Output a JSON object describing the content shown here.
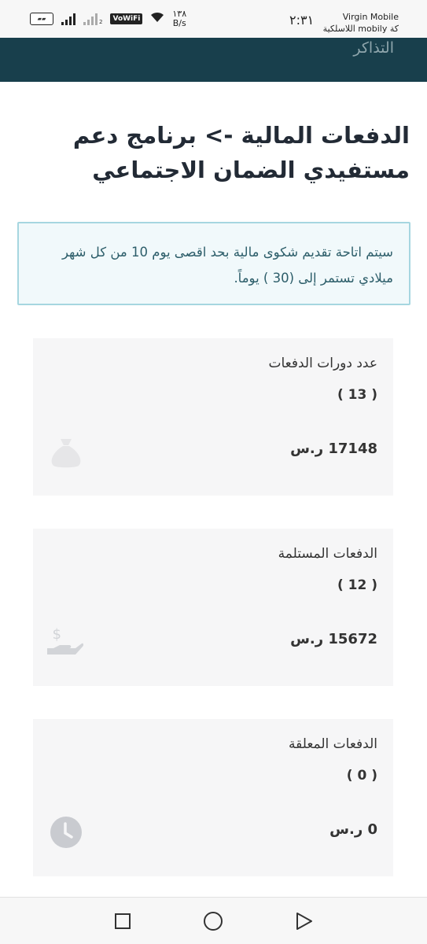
{
  "status_bar": {
    "battery": "▰▰",
    "volte": "VoWiFi",
    "sim_label": "2",
    "speed_value": "١٣٨",
    "speed_unit": "B/s",
    "time": "٢:٣١",
    "carrier_line1": "Virgin Mobile",
    "carrier_line2": "كة mobily اللاسلكية"
  },
  "header": {
    "title": "التذاكر",
    "background_color": "#183f4c"
  },
  "page": {
    "title": "الدفعات المالية -> برنامج دعم مستفيدي الضمان الاجتماعي"
  },
  "notice": {
    "text": "سيتم اتاحة تقديم شكوى مالية بحد اقصى يوم 10 من كل شهر ميلادي تستمر إلى (30 ) يوماً."
  },
  "cards": [
    {
      "label": "عدد دورات الدفعات",
      "count": "( 13 )",
      "amount": "17148 ر.س",
      "icon": "money-bag-icon"
    },
    {
      "label": "الدفعات المستلمة",
      "count": "( 12 )",
      "amount": "15672 ر.س",
      "icon": "hand-dollar-icon"
    },
    {
      "label": "الدفعات المعلقة",
      "count": "( 0 )",
      "amount": "0 ر.س",
      "icon": "clock-icon"
    }
  ],
  "nav": {
    "recents": "square-icon",
    "home": "circle-icon",
    "back": "triangle-icon"
  }
}
